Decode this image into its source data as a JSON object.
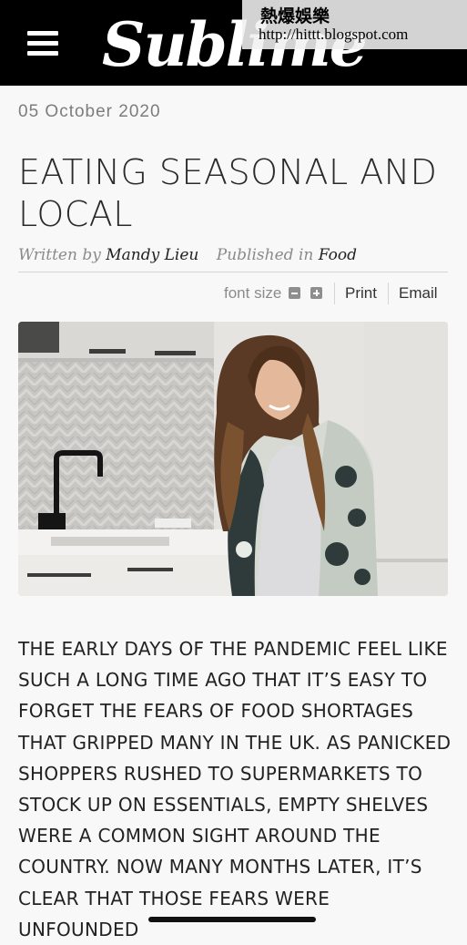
{
  "header": {
    "logo_text": "Sublime",
    "menu_icon": "hamburger-menu-icon",
    "background_color": "#000000"
  },
  "watermark": {
    "text": "熱爆娛樂",
    "url": "http://hittt.blogspot.com"
  },
  "article": {
    "date": "05 October 2020",
    "title": "EATING SEASONAL AND LOCAL",
    "written_by_label": "Written by",
    "author": "Mandy Lieu",
    "published_in_label": "Published in",
    "category": "Food",
    "tools": {
      "font_size_label": "font size",
      "decrease_icon": "minus-icon",
      "increase_icon": "plus-icon",
      "print_label": "Print",
      "email_label": "Email"
    },
    "image_subject": "woman-smiling-in-kitchen",
    "lead_paragraph": "The early days of the pandemic feel like such a long time ago that it’s easy to forget the fears of food shortages that gripped many in the UK. As panicked shoppers rushed to supermarkets to stock up on essentials, empty shelves were a common sight around the country. Now many months later, it’s clear that those fears were unfounded"
  }
}
